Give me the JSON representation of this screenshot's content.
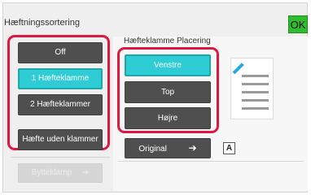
{
  "header": {
    "title": "Hæftningssortering",
    "ok_label": "OK"
  },
  "left_options": {
    "items": [
      {
        "label": "Off",
        "state": "normal"
      },
      {
        "label": "1 Hæfteklamme",
        "state": "selected"
      },
      {
        "label": "2 Hæfteklammer",
        "state": "normal"
      },
      {
        "label": "Hæfte uden klammer",
        "state": "normal"
      }
    ],
    "disabled_label": "Bytteklamp"
  },
  "placement": {
    "label": "Hæfteklamme Placering",
    "items": [
      {
        "label": "Venstre",
        "state": "selected"
      },
      {
        "label": "Top",
        "state": "normal"
      },
      {
        "label": "Højre",
        "state": "normal"
      }
    ]
  },
  "original": {
    "label": "Original",
    "arrow_icon": "arrow-right-icon",
    "orientation_glyph": "A"
  },
  "colors": {
    "accent_highlight": "#e0173e",
    "selected_button": "#2ecdd6",
    "dark_button": "#4f4f4f",
    "ok_button": "#2fbd2f",
    "staple_icon": "#2aa9e0"
  }
}
